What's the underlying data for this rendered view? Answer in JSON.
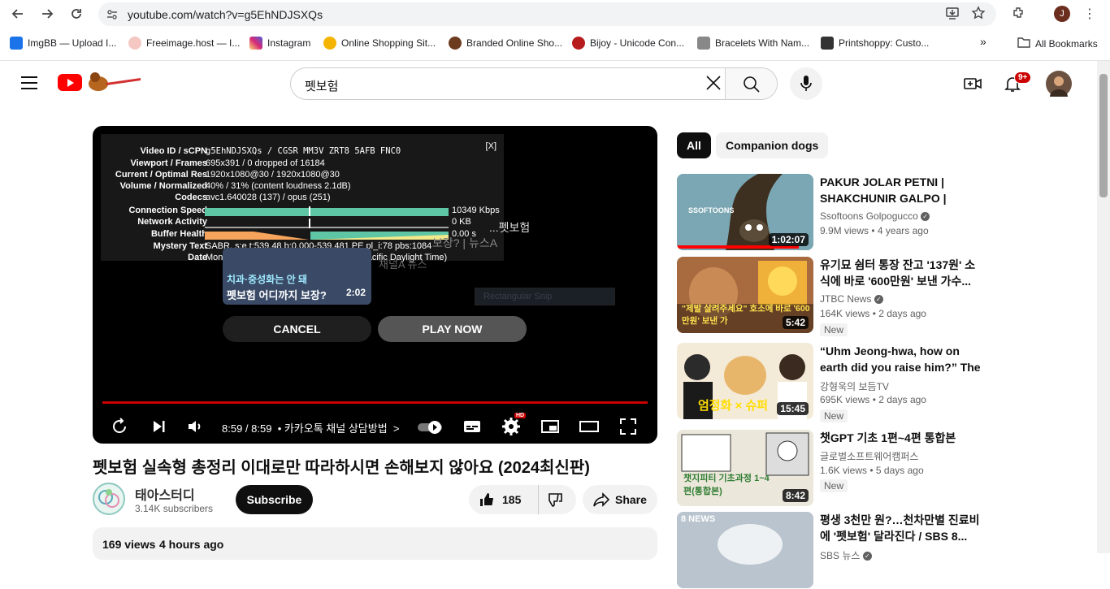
{
  "browser": {
    "url": "youtube.com/watch?v=g5EhNDJSXQs",
    "profile_initial": "J",
    "bookmarks": [
      {
        "label": "ImgBB — Upload I...",
        "color": "#1a73e8"
      },
      {
        "label": "Freeimage.host — I...",
        "color": "#f4c7c3"
      },
      {
        "label": "Instagram",
        "color": "#d6249f"
      },
      {
        "label": "Online Shopping Sit...",
        "color": "#f4b400"
      },
      {
        "label": "Branded Online Sho...",
        "color": "#6d3b1e"
      },
      {
        "label": "Bijoy - Unicode Con...",
        "color": "#b71c1c"
      },
      {
        "label": "Bracelets With Nam...",
        "color": "#888888"
      },
      {
        "label": "Printshoppy: Custo...",
        "color": "#333333"
      }
    ],
    "all_bookmarks": "All Bookmarks",
    "more": "»"
  },
  "header": {
    "search_query": "펫보험",
    "notif_count": "9+"
  },
  "player": {
    "stats": [
      {
        "key": "Video ID / sCPN",
        "value": "g5EhNDJSXQs / CGSR MM3V ZRT8 5AFB FNC0",
        "mono": true
      },
      {
        "key": "Viewport / Frames",
        "value": "695x391 / 0 dropped of 16184"
      },
      {
        "key": "Current / Optimal Res",
        "value": "1920x1080@30 / 1920x1080@30"
      },
      {
        "key": "Volume / Normalized",
        "value": "40% / 31% (content loudness 2.1dB)"
      },
      {
        "key": "Codecs",
        "value": "avc1.640028 (137) / opus (251)"
      },
      {
        "key": "Connection Speed",
        "value": "10349 Kbps"
      },
      {
        "key": "Network Activity",
        "value": "0 KB"
      },
      {
        "key": "Buffer Health",
        "value": "0.00 s"
      },
      {
        "key": "Mystery Text",
        "value": "SABR, s:e t:539.48 b:0.000-539.481 PE pl_i:78 pbs:1084"
      },
      {
        "key": "Date",
        "value": "Mon Apr 29 2024 00:55:46 GMT-0700 (Pacific Daylight Time)"
      }
    ],
    "stats_close": "[X]",
    "next_card": {
      "line1": "치과·중성화는 안 돼",
      "line2": "펫보험 어디까지 보장?",
      "duration": "2:02",
      "behind_title_a": "...펫보험",
      "behind_title_b": "보장? | 뉴스A",
      "behind_channel": "채널A 뉴스"
    },
    "ghost_snip": "Rectangular Snip",
    "cancel_label": "CANCEL",
    "play_now_label": "PLAY NOW",
    "time": "8:59 / 8:59",
    "chapter": "• 카카오톡 채널 상담방법",
    "chapter_arrow": ">",
    "hd_badge": "HD"
  },
  "video": {
    "title": "펫보험 실속형 총정리 이대로만 따라하시면 손해보지 않아요 (2024최신판)",
    "channel_name": "태아스터디",
    "subscribers": "3.14K subscribers",
    "subscribe_label": "Subscribe",
    "likes": "185",
    "share_label": "Share",
    "views": "169 views",
    "age": "4 hours ago"
  },
  "chips": [
    {
      "label": "All",
      "active": true
    },
    {
      "label": "Companion dogs",
      "active": false
    }
  ],
  "recommendations": [
    {
      "title": "PAKUR JOLAR PETNI | SHAKCHUNIR GALPO | BHOOT...",
      "channel": "Ssoftoons Golpogucco",
      "verified": true,
      "views": "9.9M views",
      "age": "4 years ago",
      "duration": "1:02:07",
      "new": "",
      "thumb_color": "#5a8a9a",
      "thumb_text": "SSOFTOONS"
    },
    {
      "title": "유기묘 쉼터 통장 잔고 '137원' 소식에 바로 '600만원' 보낸 가수...",
      "channel": "JTBC News",
      "verified": true,
      "views": "164K views",
      "age": "2 days ago",
      "duration": "5:42",
      "new": "New",
      "thumb_color": "#a0623c",
      "thumb_text": "\"제발 살려주세요\" 호소에 바로 '600만원' 보낸 가"
    },
    {
      "title": "“Uhm Jeong-hwa, how on earth did you raise him?” The Jindo...",
      "channel": "강형욱의 보듬TV",
      "verified": false,
      "views": "695K views",
      "age": "2 days ago",
      "duration": "15:45",
      "new": "New",
      "thumb_color": "#f2e6d0",
      "thumb_text": "엄정화 × 슈퍼"
    },
    {
      "title": "챗GPT 기초 1편~4편 통합본",
      "channel": "글로벌소프트웨어캠퍼스",
      "verified": false,
      "views": "1.6K views",
      "age": "5 days ago",
      "duration": "8:42",
      "new": "New",
      "thumb_color": "#e9e4d8",
      "thumb_text": "챗지피티 기초과정 1~4편(통합본)"
    },
    {
      "title": "평생 3천만 원?…천차만별 진료비에 '펫보험' 달라진다 / SBS 8...",
      "channel": "SBS 뉴스",
      "verified": true,
      "views": "",
      "age": "",
      "duration": "",
      "new": "",
      "thumb_color": "#b9c4cf",
      "thumb_text": "8 NEWS"
    }
  ]
}
